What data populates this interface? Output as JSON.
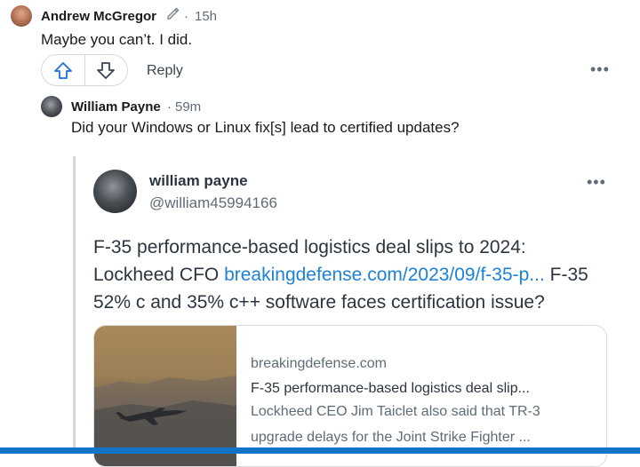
{
  "comment": {
    "author": "Andrew McGregor",
    "time": "15h",
    "text": "Maybe you can’t. I did.",
    "reply_label": "Reply",
    "more_label": "•••"
  },
  "reply": {
    "author": "William Payne",
    "time": "59m",
    "text": "Did your Windows or Linux fix[s] lead to certified updates?"
  },
  "tweet": {
    "display_name": "william payne",
    "handle": "@william45994166",
    "more_label": "•••",
    "text_part1": "F-35 performance-based logistics deal slips to 2024: Lockheed CFO ",
    "link": "breakingdefense.com/2023/09/f-35-p...",
    "text_part2": " F-35 52% c and 35% c++  software faces certification issue?",
    "card": {
      "domain": "breakingdefense.com",
      "title": "F-35 performance-based logistics deal slip...",
      "description": "Lockheed CEO Jim Taiclet also said that TR-3 upgrade delays for the Joint Strike Fighter ..."
    }
  },
  "colors": {
    "link": "#1d82d6",
    "upvote": "#1d6fd6",
    "accent_bar": "#1174c7"
  }
}
